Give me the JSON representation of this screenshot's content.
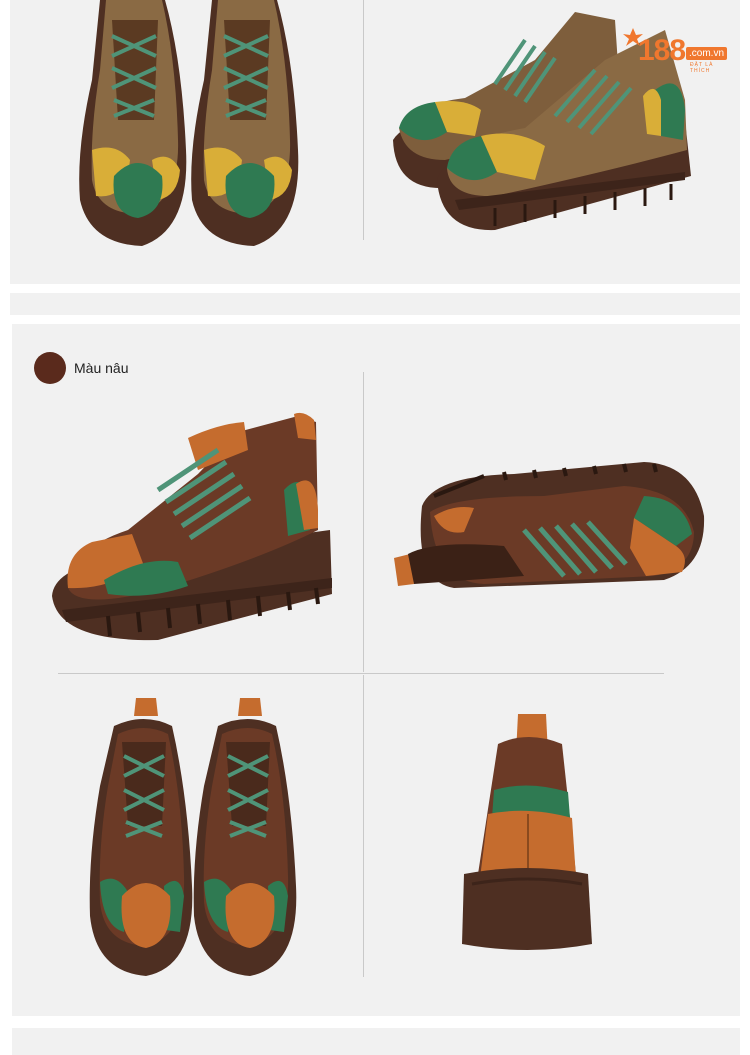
{
  "logo": {
    "number": "188",
    "domain": ".com.vn",
    "tagline": "ĐẶT LÀ THÍCH",
    "color": "#f0772e"
  },
  "variant": {
    "label": "Màu nâu",
    "swatch_color": "#5a2a1c"
  },
  "colors": {
    "panel_bg": "#f1f1f1",
    "sole": "#4e2f22",
    "leather_dark": "#6b3a26",
    "leather_olive": "#8a6a44",
    "tan": "#c56c2e",
    "mustard": "#d9ae38",
    "green": "#2f7a52",
    "lace": "#4f9478"
  }
}
